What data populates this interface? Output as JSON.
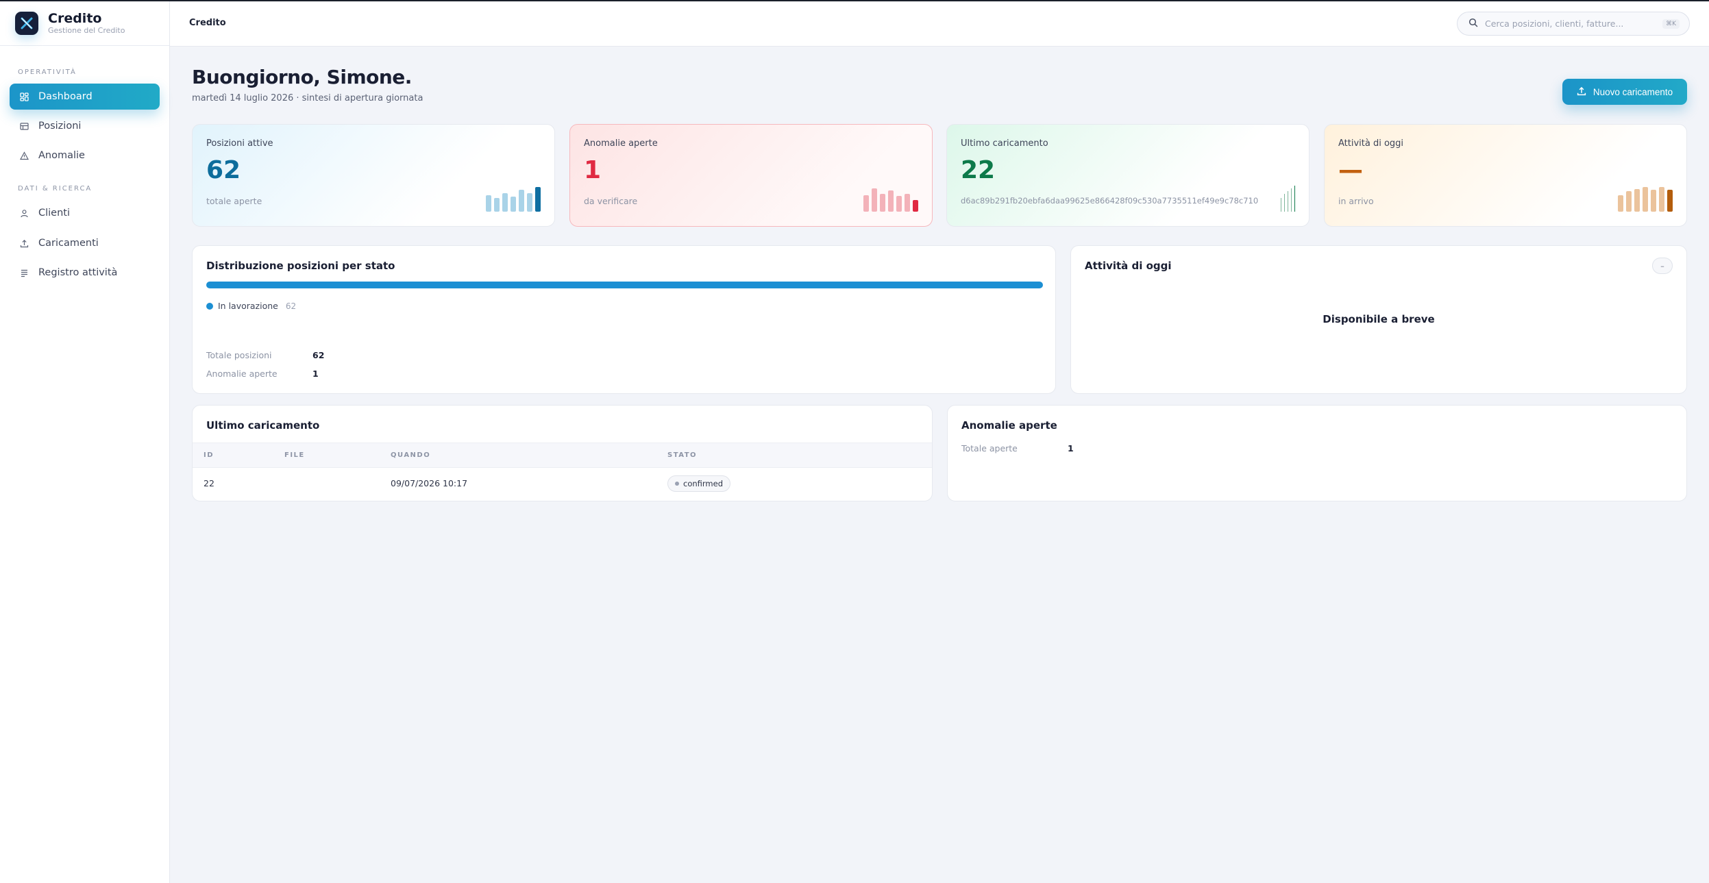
{
  "brand": {
    "title": "Credito",
    "subtitle": "Gestione del Credito"
  },
  "sidebar": {
    "sections": [
      {
        "title": "OPERATIVITÀ"
      },
      {
        "title": "DATI & RICERCA"
      }
    ],
    "items": [
      {
        "label": "Dashboard",
        "icon": "dashboard-icon",
        "active": true
      },
      {
        "label": "Posizioni",
        "icon": "table-icon"
      },
      {
        "label": "Anomalie",
        "icon": "warning-triangle-icon"
      },
      {
        "label": "Clienti",
        "icon": "user-icon"
      },
      {
        "label": "Caricamenti",
        "icon": "upload-icon"
      },
      {
        "label": "Registro attività",
        "icon": "list-icon"
      }
    ]
  },
  "header": {
    "breadcrumb": "Credito",
    "search_placeholder": "Cerca posizioni, clienti, fatture...",
    "search_shortcut": "⌘K"
  },
  "page": {
    "greeting": "Buongiorno, Simone.",
    "date_line": "martedì 14 luglio 2026 · sintesi di apertura giornata",
    "upload_button": "Nuovo caricamento"
  },
  "stats": [
    {
      "label": "Posizioni attive",
      "value": "62",
      "sub": "totale aperte",
      "color": "#0d6d9c"
    },
    {
      "label": "Anomalie aperte",
      "value": "1",
      "sub": "da verificare",
      "color": "#e02a42"
    },
    {
      "label": "Ultimo caricamento",
      "value": "22",
      "sub": "d6ac89b291fb20ebfa6daa99625e866428f09c530a7735511ef49e9c78c710",
      "color": "#0d7a4a"
    },
    {
      "label": "Attività di oggi",
      "value": "—",
      "sub": "in arrivo",
      "color": "#c2600f"
    }
  ],
  "distribution": {
    "title": "Distribuzione posizioni per stato",
    "legend": [
      {
        "label": "In lavorazione",
        "count": "62",
        "color": "#1c8fd3",
        "share": 1.0
      }
    ],
    "totals": [
      {
        "label": "Totale posizioni",
        "value": "62"
      },
      {
        "label": "Anomalie aperte",
        "value": "1"
      }
    ]
  },
  "activity": {
    "title": "Attività di oggi",
    "button": "–",
    "message": "Disponibile a breve"
  },
  "uploads": {
    "title": "Ultimo caricamento",
    "columns": [
      "ID",
      "FILE",
      "QUANDO",
      "STATO"
    ],
    "rows": [
      {
        "id": "22",
        "file": "",
        "when": "09/07/2026 10:17",
        "status": "confirmed"
      }
    ]
  },
  "anomalies": {
    "title": "Anomalie aperte",
    "label": "Totale aperte",
    "value": "1"
  }
}
